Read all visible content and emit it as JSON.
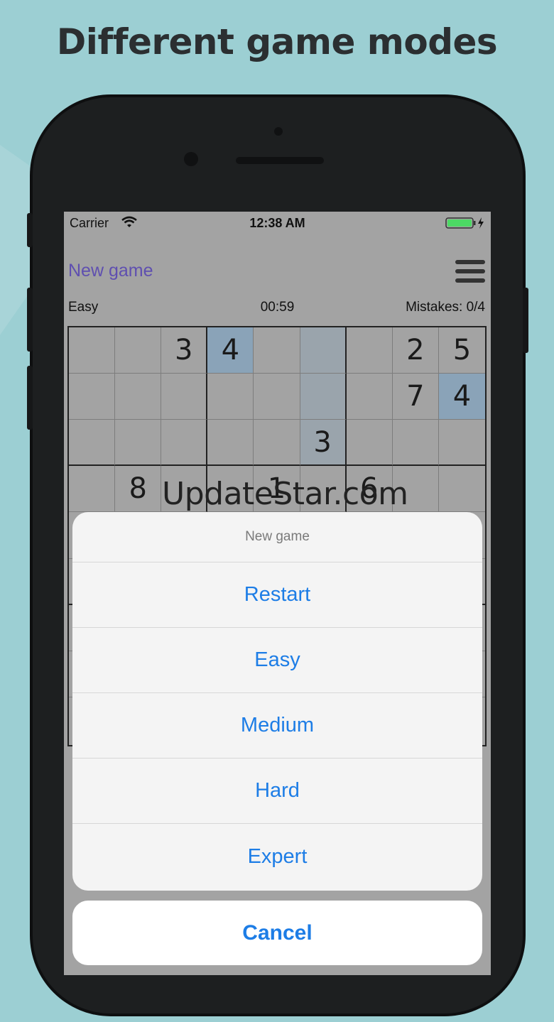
{
  "headline": "Different game modes",
  "status_bar": {
    "carrier": "Carrier",
    "time": "12:38 AM"
  },
  "nav": {
    "title": "New game"
  },
  "info": {
    "difficulty": "Easy",
    "timer": "00:59",
    "mistakes": "Mistakes: 0/4"
  },
  "board": {
    "cells": [
      {
        "row": 0,
        "col": 2,
        "value": "3",
        "highlight": false
      },
      {
        "row": 0,
        "col": 3,
        "value": "4",
        "highlight": true
      },
      {
        "row": 0,
        "col": 7,
        "value": "2",
        "highlight": false
      },
      {
        "row": 0,
        "col": 8,
        "value": "5",
        "highlight": false
      },
      {
        "row": 1,
        "col": 7,
        "value": "7",
        "highlight": false
      },
      {
        "row": 1,
        "col": 8,
        "value": "4",
        "highlight": true
      },
      {
        "row": 2,
        "col": 5,
        "value": "3",
        "highlight": false
      },
      {
        "row": 3,
        "col": 1,
        "value": "8",
        "highlight": false
      },
      {
        "row": 3,
        "col": 4,
        "value": "1",
        "highlight": false
      },
      {
        "row": 3,
        "col": 6,
        "value": "6",
        "highlight": false
      }
    ],
    "shaded_column": 5,
    "shaded_rows": [
      0,
      1,
      2
    ],
    "highlight_color": "#8aa3b8",
    "shade_color": "#9aa4ac"
  },
  "watermark": "UpdateStar.com",
  "action_sheet": {
    "title": "New game",
    "items": [
      "Restart",
      "Easy",
      "Medium",
      "Hard",
      "Expert"
    ],
    "cancel": "Cancel"
  },
  "colors": {
    "accent": "#1d7de6",
    "nav_title": "#5f4fb0",
    "background": "#9ccfd3"
  }
}
